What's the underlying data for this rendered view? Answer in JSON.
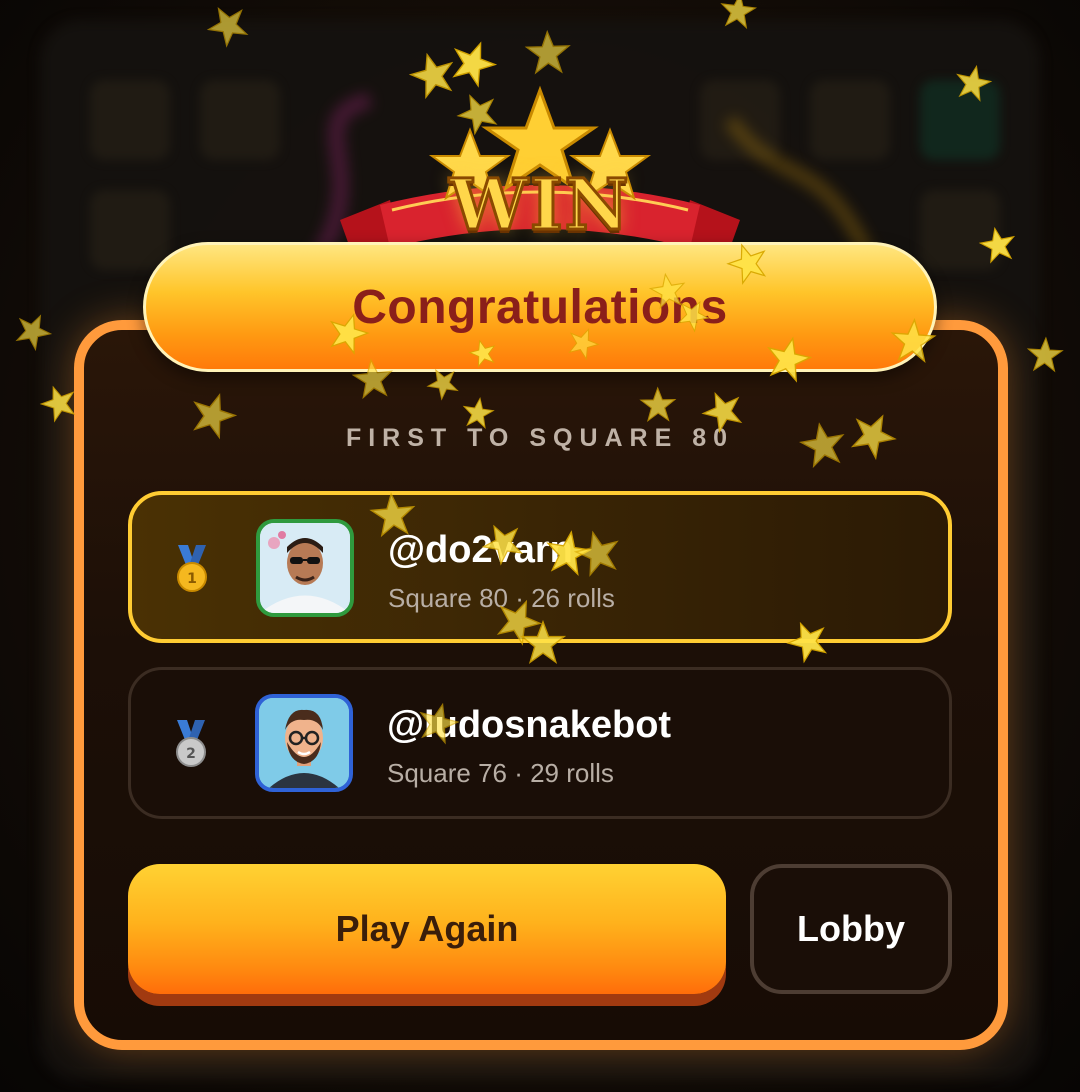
{
  "banner": {
    "win_text": "WIN"
  },
  "modal": {
    "title": "Congratulations",
    "subtitle": "FIRST TO SQUARE 80",
    "players": [
      {
        "rank": 1,
        "medal_icon": "gold-medal-icon",
        "username": "@do2varn",
        "stats": "Square 80 · 26 rolls",
        "avatar_border_color": "#2f9a3e",
        "highlighted": true
      },
      {
        "rank": 2,
        "medal_icon": "silver-medal-icon",
        "username": "@ludosnakebot",
        "stats": "Square 76 · 29 rolls",
        "avatar_border_color": "#2f62d6",
        "highlighted": false
      }
    ],
    "buttons": {
      "play_again_label": "Play Again",
      "lobby_label": "Lobby"
    }
  },
  "colors": {
    "card_border": "#ff9a3c",
    "highlight_border": "#ffcc33",
    "title_text": "#8a1f1a",
    "star": "#ffe347"
  }
}
